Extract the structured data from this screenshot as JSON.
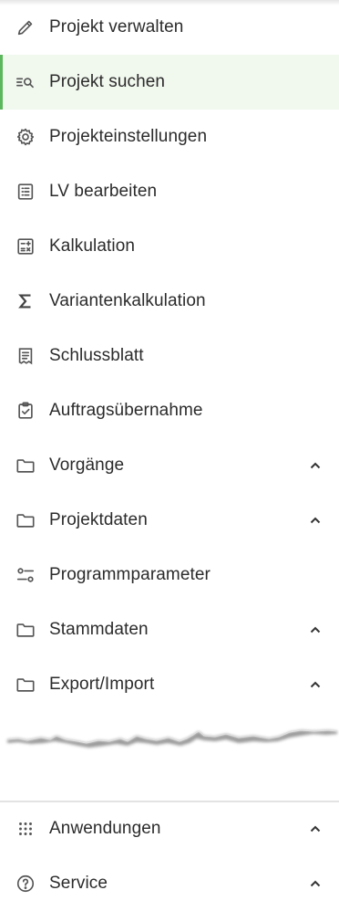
{
  "menu": {
    "items": [
      {
        "label": "Projekt verwalten",
        "icon": "pencil-icon"
      },
      {
        "label": "Projekt suchen",
        "icon": "search-list-icon",
        "active": true
      },
      {
        "label": "Projekteinstellungen",
        "icon": "gear-icon"
      },
      {
        "label": "LV bearbeiten",
        "icon": "list-icon"
      },
      {
        "label": "Kalkulation",
        "icon": "calculator-icon"
      },
      {
        "label": "Variantenkalkulation",
        "icon": "sigma-icon"
      },
      {
        "label": "Schlussblatt",
        "icon": "document-icon"
      },
      {
        "label": "Auftragsübernahme",
        "icon": "clipboard-check-icon"
      },
      {
        "label": "Vorgänge",
        "icon": "folder-icon",
        "expandable": true
      },
      {
        "label": "Projektdaten",
        "icon": "folder-icon",
        "expandable": true
      },
      {
        "label": "Programmparameter",
        "icon": "settings-sliders-icon"
      },
      {
        "label": "Stammdaten",
        "icon": "folder-icon",
        "expandable": true
      },
      {
        "label": "Export/Import",
        "icon": "folder-icon",
        "expandable": true
      }
    ]
  },
  "bottom": {
    "items": [
      {
        "label": "Anwendungen",
        "icon": "apps-grid-icon",
        "expandable": true
      },
      {
        "label": "Service",
        "icon": "help-circle-icon",
        "expandable": true
      }
    ]
  },
  "colors": {
    "active_bg": "#f1f8ee",
    "active_bar": "#5cb85c",
    "text": "#2b2b2b",
    "icon": "#555555"
  }
}
